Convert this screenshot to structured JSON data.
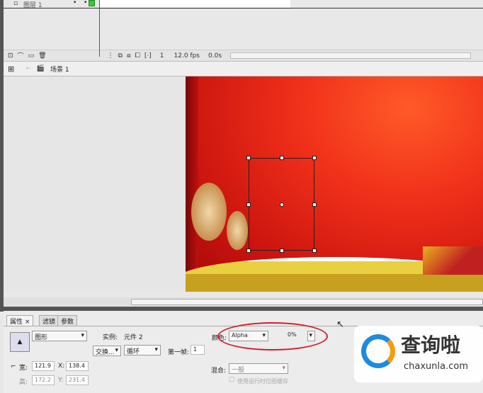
{
  "timeline": {
    "layer_name": "图层 1",
    "frame": "1",
    "fps": "12.0 fps",
    "time": "0.0s"
  },
  "scene": {
    "name": "场景 1"
  },
  "properties": {
    "tabs": [
      "属性",
      "滤镜",
      "参数"
    ],
    "symbol_type": "图形",
    "instance_label": "实例:",
    "instance_name": "元件 2",
    "swap_button": "交换...",
    "loop": "循环",
    "first_frame_label": "第一帧:",
    "first_frame": "1",
    "width_label": "宽:",
    "width": "121.9",
    "x_label": "X:",
    "x": "138.4",
    "height_label": "高:",
    "height": "172.2",
    "y_label": "Y:",
    "y": "231.4",
    "color_label": "颜色:",
    "color_mode": "Alpha",
    "alpha": "0%",
    "blend_label": "混合:",
    "blend": "一般",
    "cache_label": "使用运行时位图缓存"
  },
  "watermark": {
    "text": "查询啦",
    "url": "chaxunla.com"
  },
  "colors": {
    "stage": "#e8281a",
    "highlight": "#d0202a"
  }
}
